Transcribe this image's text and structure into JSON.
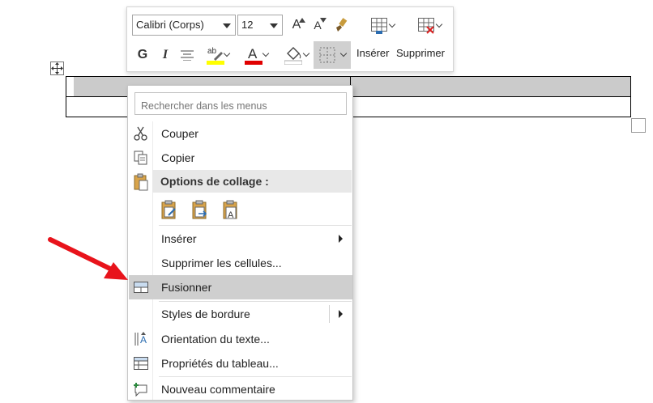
{
  "mini_toolbar": {
    "font_name": "Calibri (Corps)",
    "font_size": "12",
    "grow_font_glyph": "A",
    "shrink_font_glyph": "A",
    "bold_glyph": "G",
    "italic_glyph": "I",
    "insert_label": "Insérer",
    "delete_label": "Supprimer",
    "highlight_color": "#ffff00",
    "font_color": "#e00000"
  },
  "context_menu": {
    "search_placeholder": "Rechercher dans les menus",
    "items": {
      "cut": "Couper",
      "copy": "Copier",
      "paste_options": "Options de collage :",
      "insert": "Insérer",
      "delete_cells": "Supprimer les cellules...",
      "merge": "Fusionner",
      "border_styles": "Styles de bordure",
      "text_direction": "Orientation du texte...",
      "table_properties": "Propriétés du tableau...",
      "new_comment": "Nouveau commentaire"
    }
  },
  "colors": {
    "highlight_row": "#cfcfcf",
    "selection": "#cbcbcb",
    "annotation_arrow": "#e8131b"
  }
}
